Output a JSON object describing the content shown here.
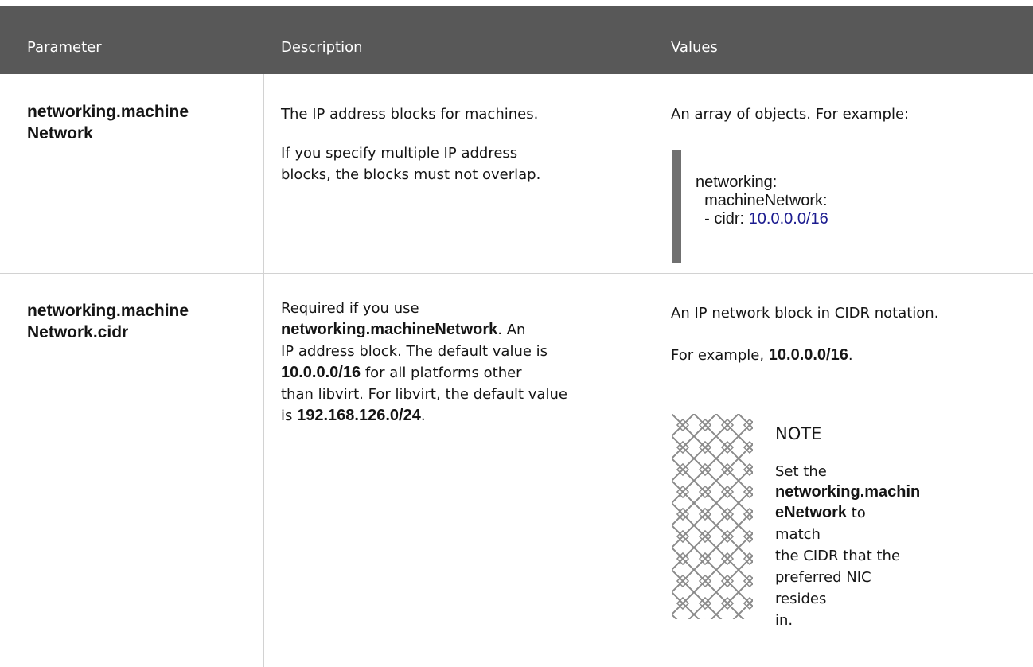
{
  "headers": {
    "parameter": "Parameter",
    "description": "Description",
    "values": "Values"
  },
  "rows": [
    {
      "param_line1": "networking.machine",
      "param_line2": "Network",
      "desc_p1": "The IP address blocks for machines.",
      "desc_p2_line1": "If you specify multiple IP address",
      "desc_p2_line2": "blocks, the blocks must not overlap.",
      "values_intro": "An array of objects. For example:",
      "code_line1": "networking:",
      "code_line2": "  machineNetwork:",
      "code_line3_prefix": "  - cidr: ",
      "code_line3_value": "10.0.0.0/16"
    },
    {
      "param_line1": "networking.machine",
      "param_line2": "Network.cidr",
      "desc_line1": "Required if you use",
      "desc_bold1": "networking.machineNetwork",
      "desc_after_bold1": ". An",
      "desc_line3": "IP address block. The default value is",
      "desc_bold2": "10.0.0.0/16",
      "desc_after_bold2": " for all platforms other",
      "desc_line5": "than libvirt. For libvirt, the default value",
      "desc_line6_prefix": "is ",
      "desc_bold3": "192.168.126.0/24",
      "desc_line6_suffix": ".",
      "values_p1": "An IP network block in CIDR notation.",
      "values_p2_prefix": "For example, ",
      "values_p2_bold": "10.0.0.0/16",
      "values_p2_suffix": ".",
      "note": {
        "title": "NOTE",
        "line1": "Set the",
        "bold_line1": "networking.machin",
        "bold_line2": "eNetwork",
        "after_bold": " to match",
        "line4": "the CIDR that the",
        "line5": "preferred NIC resides",
        "line6": "in."
      }
    }
  ]
}
